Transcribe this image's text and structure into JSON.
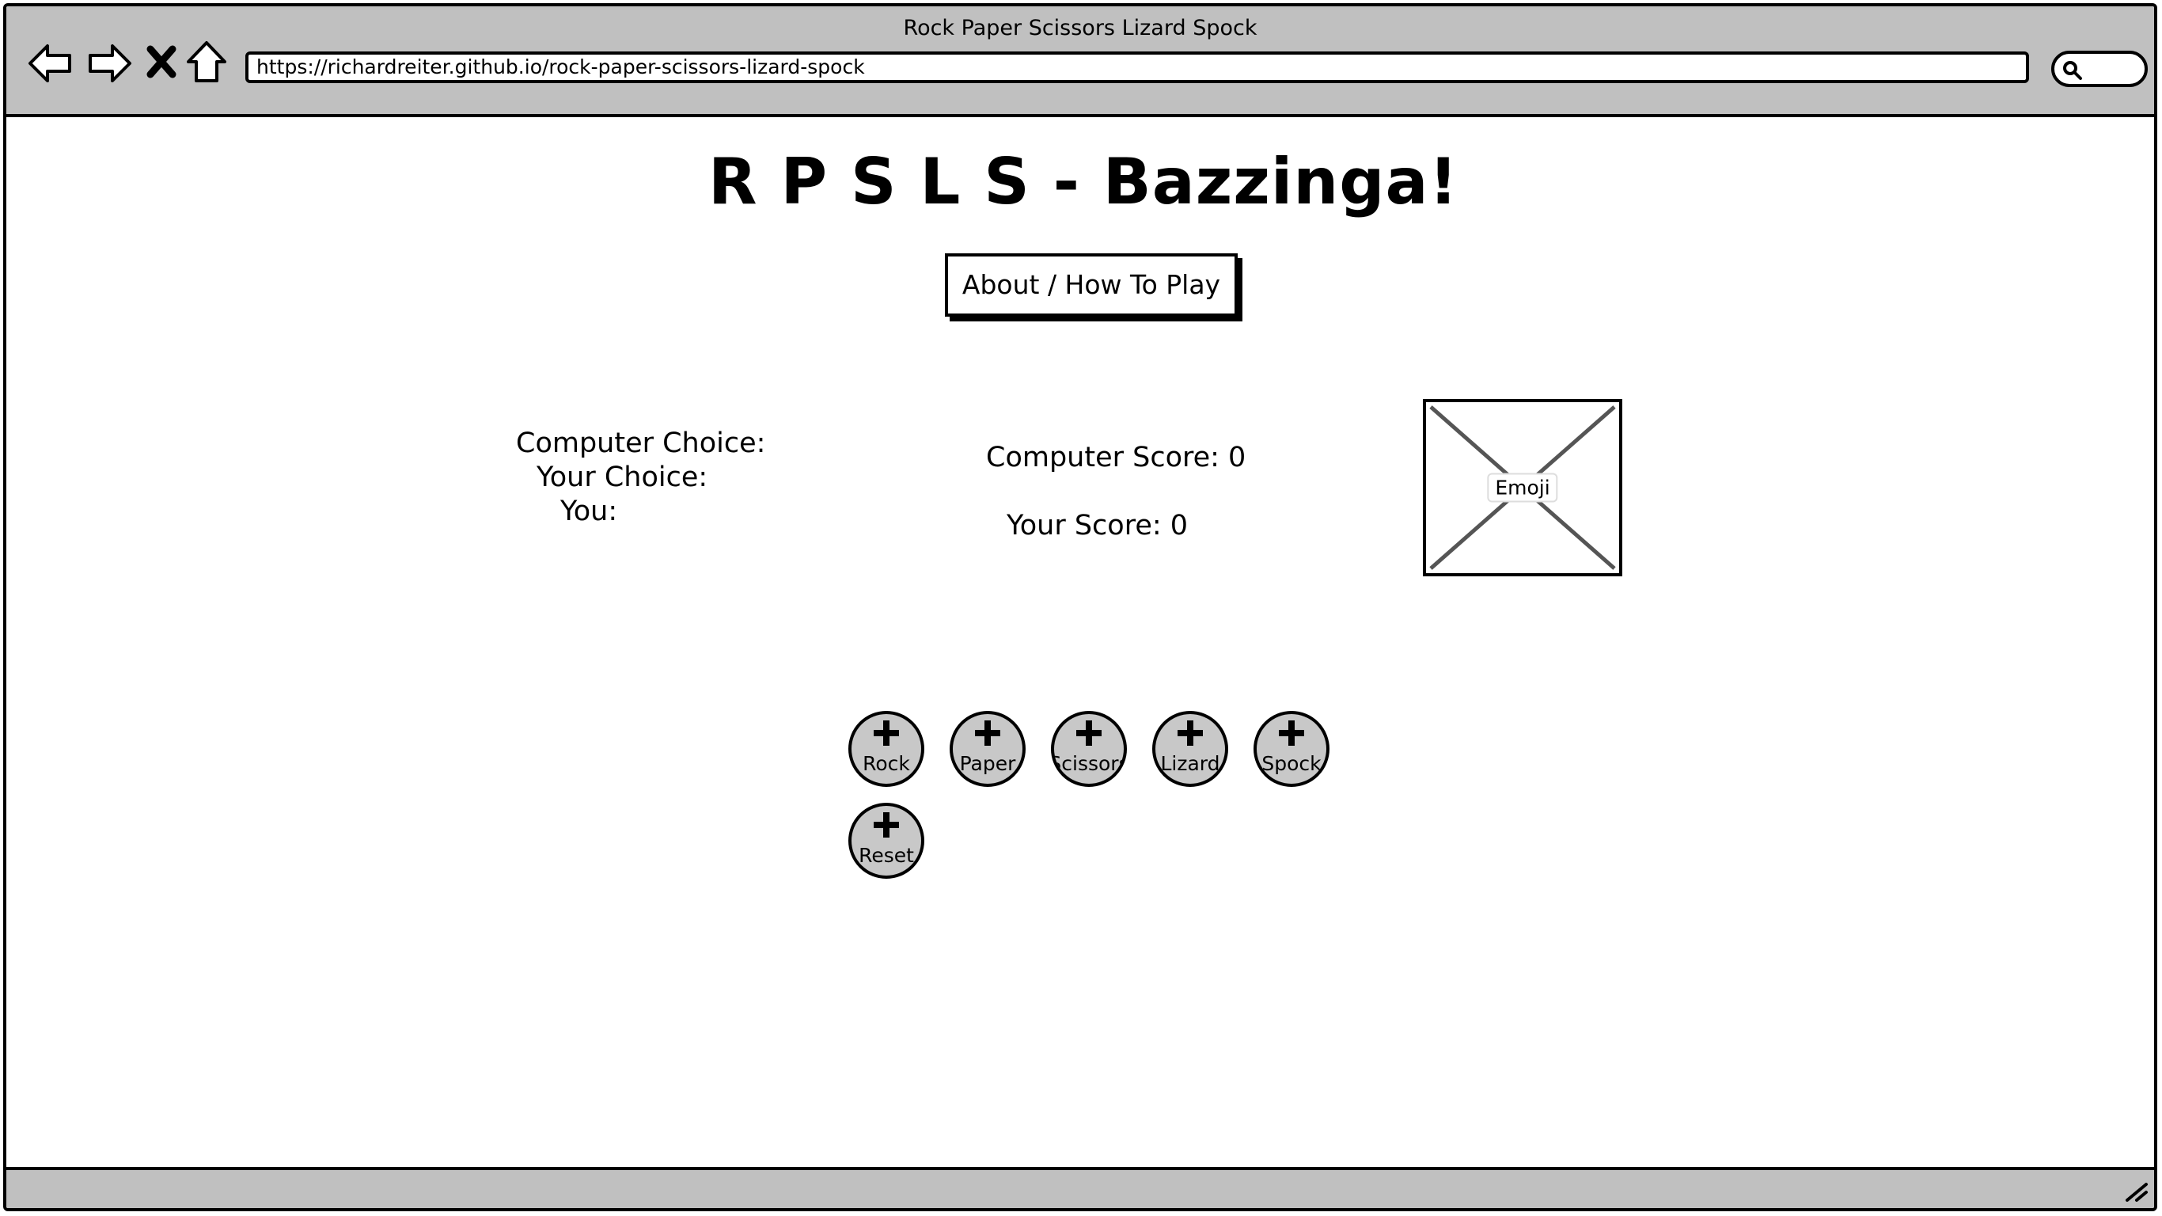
{
  "browser": {
    "window_title": "Rock Paper Scissors Lizard Spock",
    "url": "https://richardreiter.github.io/rock-paper-scissors-lizard-spock",
    "nav_icons": [
      "back-arrow-icon",
      "forward-arrow-icon",
      "stop-icon",
      "home-icon"
    ],
    "search_icon": "search-icon"
  },
  "page": {
    "title": "R P S L S - Bazzinga!",
    "about_button": "About / How To Play",
    "status": {
      "computer_choice_label": "Computer Choice:",
      "your_choice_label": "Your Choice:",
      "you_label": "You:"
    },
    "scores": {
      "computer": "Computer Score: 0",
      "you": "Your Score: 0"
    },
    "emoji_placeholder": "Emoji",
    "choices": [
      "Rock",
      "Paper",
      "Scissors",
      "Lizard",
      "Spock"
    ],
    "reset": "Reset"
  },
  "colors": {
    "chrome_gray": "#c0c0c0",
    "button_gray": "#c8c8c8",
    "ink": "#000000",
    "placeholder_cross": "#555555"
  }
}
